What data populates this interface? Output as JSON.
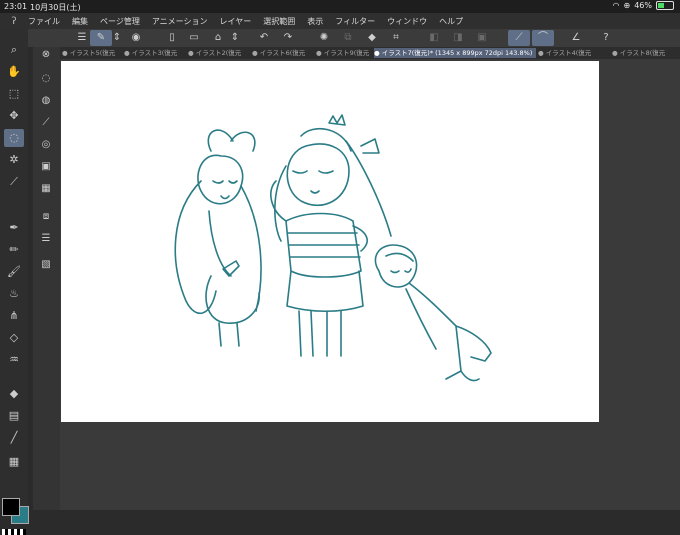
{
  "status_bar": {
    "time": "23:01",
    "date": "10月30日(土)",
    "battery": "46%",
    "battery_fraction": 0.46
  },
  "menu": [
    "ファイル",
    "編集",
    "ページ管理",
    "アニメーション",
    "レイヤー",
    "選択範囲",
    "表示",
    "フィルター",
    "ウィンドウ",
    "ヘルプ"
  ],
  "tabs": [
    "イラスト5(復元",
    "イラスト3(復元",
    "イラスト2(復元",
    "イラスト6(復元",
    "イラスト9(復元",
    "イラスト7(復元)* (1345 x 899px 72dpi 143.8%)",
    "イラスト4(復元",
    "イラスト8(復元"
  ],
  "active_tab_index": 5,
  "colors": {
    "main_color": "#000000",
    "sub_color": "#2a7c86",
    "line_color": "#2a7c86"
  }
}
